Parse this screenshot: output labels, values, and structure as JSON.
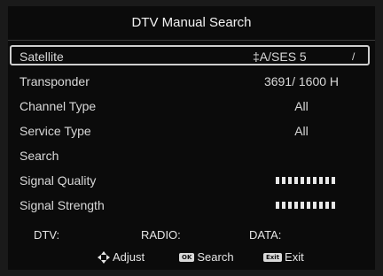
{
  "title": "DTV Manual Search",
  "rows": [
    {
      "label": "Satellite",
      "value": "‡A/SES 5"
    },
    {
      "label": "Transponder",
      "value": "3691/ 1600 H"
    },
    {
      "label": "Channel Type",
      "value": "All"
    },
    {
      "label": "Service Type",
      "value": "All"
    },
    {
      "label": "Search",
      "value": ""
    },
    {
      "label": "Signal Quality",
      "value": ""
    },
    {
      "label": "Signal Strength",
      "value": ""
    }
  ],
  "signal_quality_level": 10,
  "signal_strength_level": 10,
  "selected_row_arrow": "/",
  "counts": {
    "dtv": "DTV:",
    "radio": "RADIO:",
    "data": "DATA:"
  },
  "footer": {
    "adjust_label": "Adjust",
    "search_key": "OK",
    "search_label": "Search",
    "exit_key": "Exit",
    "exit_label": "Exit"
  },
  "icons": {
    "adjust": "dpad-icon",
    "ok": "ok-key-icon",
    "exit": "exit-key-icon"
  },
  "colors": {
    "background": "#0b0b0b",
    "text": "#d8d8d8",
    "selection_border": "#cfcfcf"
  }
}
